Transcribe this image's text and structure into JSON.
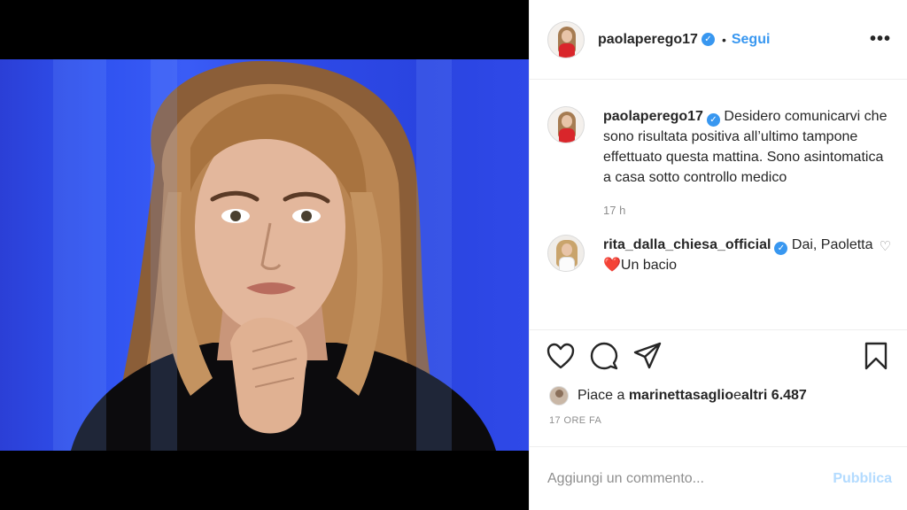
{
  "post": {
    "author": "paolaperego17",
    "follow_label": "Segui",
    "dot": "•",
    "more_label": "•••",
    "caption": "Desidero comunicarvi che sono risultata positiva all’ultimo tampone effettuato questa mattina. Sono asintomatica a casa sotto controllo medico",
    "caption_time": "17 h"
  },
  "comments": [
    {
      "author": "rita_dalla_chiesa_official",
      "text_before": "Dai, Paoletta ",
      "emoji": "❤️",
      "text_after": "Un bacio"
    }
  ],
  "likes": {
    "prefix": "Piace a ",
    "user": "marinettasaglio",
    "middle": " e ",
    "others": "altri 6.487"
  },
  "post_time": "17 ORE FA",
  "add_comment": {
    "placeholder": "Aggiungi un commento...",
    "publish_label": "Pubblica"
  },
  "colors": {
    "link_blue": "#3897f0",
    "publish_disabled": "#b3dbff",
    "photo_background": "#2f52f0"
  }
}
